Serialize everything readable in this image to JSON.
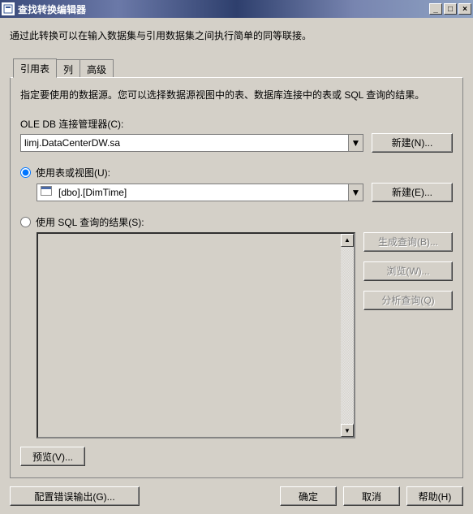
{
  "title": "查找转换编辑器",
  "description": "通过此转换可以在输入数据集与引用数据集之间执行简单的同等联接。",
  "tabs": {
    "ref": "引用表",
    "cols": "列",
    "advanced": "高级"
  },
  "page": {
    "intro": "指定要使用的数据源。您可以选择数据源视图中的表、数据库连接中的表或 SQL 查询的结果。",
    "oledb_label": "OLE DB 连接管理器(C):",
    "oledb_value": "limj.DataCenterDW.sa",
    "new_btn_n": "新建(N)...",
    "radio_table": "使用表或视图(U):",
    "table_value": "[dbo].[DimTime]",
    "new_btn_e": "新建(E)...",
    "radio_sql": "使用 SQL 查询的结果(S):",
    "gen_query": "生成查询(B)...",
    "browse": "浏览(W)...",
    "parse_query": "分析查询(Q)",
    "preview": "预览(V)..."
  },
  "footer": {
    "error_output": "配置错误输出(G)...",
    "ok": "确定",
    "cancel": "取消",
    "help": "帮助(H)"
  }
}
